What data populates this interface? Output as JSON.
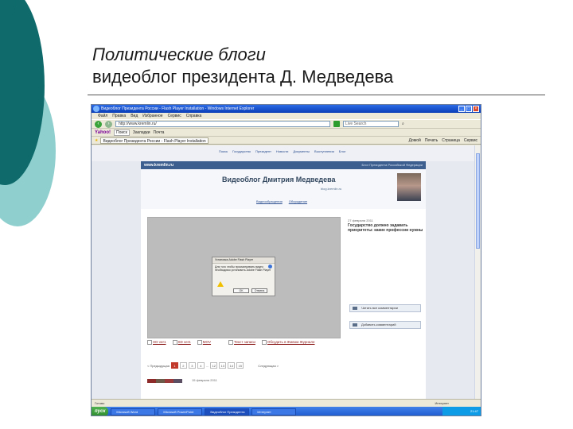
{
  "slide": {
    "title_line1": "Политические блоги",
    "title_line2": "видеоблог президента Д. Медведева",
    "colors": {
      "teal_dark": "#0f6b6b",
      "teal_light": "#8fd0cf"
    }
  },
  "browser": {
    "window_title": "Видеоблог Президента России - Flash Player Installation - Windows Internet Explorer",
    "menu": [
      "Файл",
      "Правка",
      "Вид",
      "Избранное",
      "Сервис",
      "Справка"
    ],
    "address": "http://www.kremlin.ru/",
    "search_placeholder": "Live Search",
    "links_bar": [
      "Yahoo!",
      "Поиск",
      "Закладки",
      "Почта"
    ],
    "tab": "Видеоблог Президента России - Flash Player Installation",
    "tab_tools": [
      "Домой",
      "Печать",
      "Страница",
      "Сервис"
    ]
  },
  "site": {
    "top_links": [
      "Поиск",
      "Государство",
      "Президент",
      "Новости",
      "Документы",
      "Выступления",
      "Блог"
    ],
    "logo": "www.kremlin.ru",
    "header_right": "Блог Президента Российской Федерации",
    "title": "Видеоблог Дмитрия Медведева",
    "subtitle": "blog.kremlin.ru",
    "subnav": [
      "Видеообращения",
      "Обсуждение"
    ],
    "post_date": "27 февраля 2011",
    "post_title": "Государство должно задавать приоритеты: какие профессии нужны",
    "side_buttons": [
      "Читать все комментарии",
      "Добавить комментарий"
    ],
    "formats": [
      "HD ver1",
      "SD ver1",
      "MOV",
      "Текст записи",
      "Обсудить в Живом Журнале"
    ],
    "pager_prev": "< Предыдущая",
    "pages": [
      "1",
      "2",
      "3",
      "4",
      "...",
      "12",
      "13",
      "14",
      "15"
    ],
    "pager_next": "Следующая >",
    "thumb_date": "15 февраля 2011",
    "dialog": {
      "title": "Установка Adobe Flash Player",
      "text": "Для того чтобы просматривать видео необходимо установить Adobe Flash Player",
      "ok": "OK",
      "cancel": "Отмена"
    }
  },
  "statusbar": {
    "text": "Готово",
    "zone": "Интернет"
  },
  "taskbar": {
    "start": "пуск",
    "tasks": [
      "Microsoft Word",
      "Microsoft PowerPoint",
      "Видеоблог Президента",
      "Интернет"
    ],
    "time": "21:47"
  }
}
